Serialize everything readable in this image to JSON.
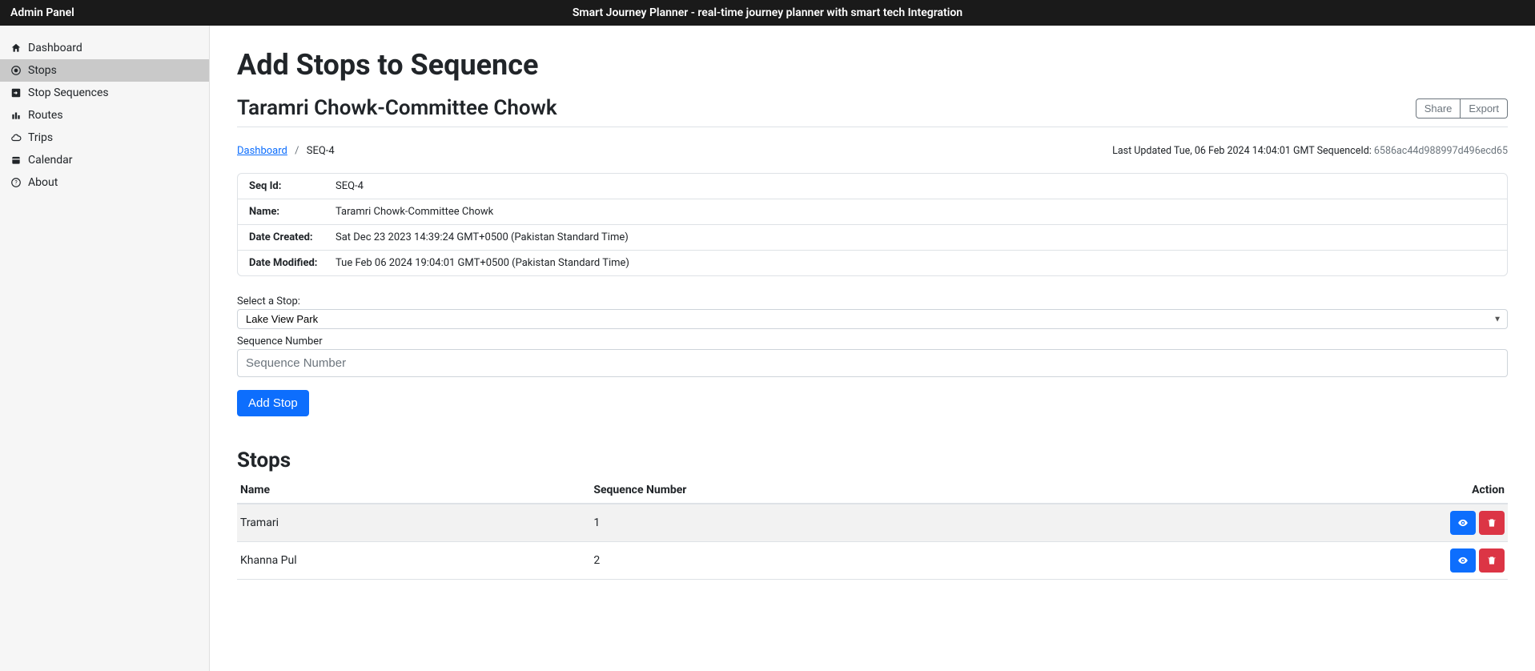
{
  "topbar": {
    "left": "Admin Panel",
    "center": "Smart Journey Planner - real-time journey planner with smart tech Integration"
  },
  "sidebar": {
    "items": [
      {
        "label": "Dashboard",
        "icon": "home"
      },
      {
        "label": "Stops",
        "icon": "dot",
        "active": true
      },
      {
        "label": "Stop Sequences",
        "icon": "arrow-box"
      },
      {
        "label": "Routes",
        "icon": "bars"
      },
      {
        "label": "Trips",
        "icon": "cloud"
      },
      {
        "label": "Calendar",
        "icon": "calendar"
      },
      {
        "label": "About",
        "icon": "question"
      }
    ]
  },
  "page": {
    "title": "Add Stops to Sequence",
    "seq_name": "Taramri Chowk-Committee Chowk",
    "share": "Share",
    "export": "Export",
    "breadcrumb": {
      "root": "Dashboard",
      "current": "SEQ-4"
    },
    "meta": {
      "last_updated": "Last Updated Tue, 06 Feb 2024 14:04:01 GMT SequenceId: ",
      "hash": "6586ac44d988997d496ecd65"
    },
    "info": {
      "seq_id_label": "Seq Id:",
      "seq_id": "SEQ-4",
      "name_label": "Name:",
      "name": "Taramri Chowk-Committee Chowk",
      "created_label": "Date Created:",
      "created": "Sat Dec 23 2023 14:39:24 GMT+0500 (Pakistan Standard Time)",
      "modified_label": "Date Modified:",
      "modified": "Tue Feb 06 2024 19:04:01 GMT+0500 (Pakistan Standard Time)"
    },
    "form": {
      "select_label": "Select a Stop:",
      "select_value": "Lake View Park",
      "seqnum_label": "Sequence Number",
      "seqnum_placeholder": "Sequence Number",
      "add_btn": "Add Stop"
    },
    "stops": {
      "title": "Stops",
      "headers": {
        "name": "Name",
        "seqnum": "Sequence Number",
        "action": "Action"
      },
      "rows": [
        {
          "name": "Tramari",
          "seqnum": "1"
        },
        {
          "name": "Khanna Pul",
          "seqnum": "2"
        }
      ]
    }
  }
}
